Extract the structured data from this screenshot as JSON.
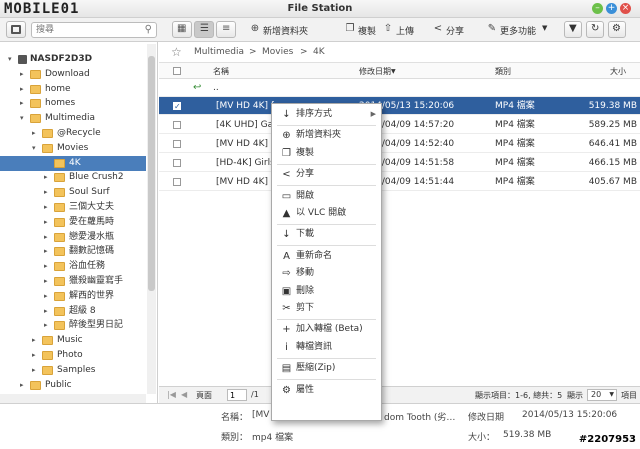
{
  "window": {
    "title": "File Station",
    "logo_text": "MOBILE01"
  },
  "toolbar": {
    "search_placeholder": "搜尋",
    "new_folder": "新增資料夾",
    "copy": "複製",
    "upload": "上傳",
    "share": "分享",
    "more": "更多功能"
  },
  "sidebar": {
    "items": [
      {
        "label": "NASDF2D3D",
        "level": 0,
        "arrow": "▾",
        "folder": false,
        "selected": false
      },
      {
        "label": "Download",
        "level": 1,
        "arrow": "▸",
        "folder": true,
        "selected": false
      },
      {
        "label": "home",
        "level": 1,
        "arrow": "▸",
        "folder": true,
        "selected": false
      },
      {
        "label": "homes",
        "level": 1,
        "arrow": "▸",
        "folder": true,
        "selected": false
      },
      {
        "label": "Multimedia",
        "level": 1,
        "arrow": "▾",
        "folder": true,
        "selected": false
      },
      {
        "label": "@Recycle",
        "level": 2,
        "arrow": "▸",
        "folder": true,
        "selected": false
      },
      {
        "label": "Movies",
        "level": 2,
        "arrow": "▾",
        "folder": true,
        "selected": false
      },
      {
        "label": "4K",
        "level": 3,
        "arrow": "",
        "folder": true,
        "selected": true
      },
      {
        "label": "Blue Crush2",
        "level": 3,
        "arrow": "▸",
        "folder": true,
        "selected": false
      },
      {
        "label": "Soul Surf",
        "level": 3,
        "arrow": "▸",
        "folder": true,
        "selected": false
      },
      {
        "label": "三個大丈夫",
        "level": 3,
        "arrow": "▸",
        "folder": true,
        "selected": false
      },
      {
        "label": "愛在蘿馬時",
        "level": 3,
        "arrow": "▸",
        "folder": true,
        "selected": false
      },
      {
        "label": "戀愛漫水瓶",
        "level": 3,
        "arrow": "▸",
        "folder": true,
        "selected": false
      },
      {
        "label": "翻數記憶碼",
        "level": 3,
        "arrow": "▸",
        "folder": true,
        "selected": false
      },
      {
        "label": "浴血任務",
        "level": 3,
        "arrow": "▸",
        "folder": true,
        "selected": false
      },
      {
        "label": "獵殺幽靈寫手",
        "level": 3,
        "arrow": "▸",
        "folder": true,
        "selected": false
      },
      {
        "label": "解西的世界",
        "level": 3,
        "arrow": "▸",
        "folder": true,
        "selected": false
      },
      {
        "label": "超級 8",
        "level": 3,
        "arrow": "▸",
        "folder": true,
        "selected": false
      },
      {
        "label": "醉後型男日記",
        "level": 3,
        "arrow": "▸",
        "folder": true,
        "selected": false
      },
      {
        "label": "Music",
        "level": 2,
        "arrow": "▸",
        "folder": true,
        "selected": false
      },
      {
        "label": "Photo",
        "level": 2,
        "arrow": "▸",
        "folder": true,
        "selected": false
      },
      {
        "label": "Samples",
        "level": 2,
        "arrow": "▸",
        "folder": true,
        "selected": false
      },
      {
        "label": "Public",
        "level": 1,
        "arrow": "▸",
        "folder": true,
        "selected": false
      }
    ]
  },
  "breadcrumb": {
    "items": [
      "Multimedia",
      "Movies",
      "4K"
    ],
    "separator": ">"
  },
  "table": {
    "headers": {
      "name": "名稱",
      "date": "修改日期",
      "type": "類別",
      "size": "大小"
    },
    "parent_row": "..",
    "rows": [
      {
        "name": "[MV HD 4K] f",
        "date": "2014/05/13 15:20:06",
        "type": "MP4 檔案",
        "size": "519.38 MB",
        "checked": true
      },
      {
        "name": "[4K UHD] Gal",
        "date": "2014/04/09 14:57:20",
        "type": "MP4 檔案",
        "size": "589.25 MB",
        "checked": false
      },
      {
        "name": "[MV HD 4K] G",
        "date": "2014/04/09 14:52:40",
        "type": "MP4 檔案",
        "size": "646.41 MB",
        "checked": false
      },
      {
        "name": "[HD-4K] Girls",
        "date": "2014/04/09 14:51:58",
        "type": "MP4 檔案",
        "size": "466.15 MB",
        "checked": false
      },
      {
        "name": "[MV HD 4K] 9",
        "date": "2014/04/09 14:51:44",
        "type": "MP4 檔案",
        "size": "405.67 MB",
        "checked": false
      }
    ]
  },
  "pager": {
    "page_label": "頁面",
    "page_value": "1",
    "page_total": "/1",
    "display_info": "顯示項目：1-6, 總共：5",
    "per_page_label": "顯示",
    "per_page_value": "20",
    "items_label": "項目"
  },
  "info": {
    "name_label": "名稱：",
    "name_value": "[MV",
    "name_value_tail": "dom Tooth (劣…",
    "date_label": "修改日期",
    "date_value": "2014/05/13 15:20:06",
    "type_label": "類別：",
    "type_value": "mp4 檔案",
    "size_label": "大小：",
    "size_value": "519.38 MB"
  },
  "watermark": "#2207953",
  "context_menu": {
    "items": [
      {
        "label": "排序方式",
        "icon": "sort-icon",
        "glyph": "↓",
        "submenu": true,
        "sep_after": true
      },
      {
        "label": "新增資料夾",
        "icon": "plus-circle-icon",
        "glyph": "⊕",
        "submenu": false,
        "sep_after": false
      },
      {
        "label": "複製",
        "icon": "copy-icon",
        "glyph": "❐",
        "submenu": false,
        "sep_after": true
      },
      {
        "label": "分享",
        "icon": "share-icon",
        "glyph": "<",
        "submenu": false,
        "sep_after": true
      },
      {
        "label": "開啟",
        "icon": "folder-open-icon",
        "glyph": "▭",
        "submenu": false,
        "sep_after": false
      },
      {
        "label": "以 VLC 開啟",
        "icon": "vlc-icon",
        "glyph": "▲",
        "submenu": false,
        "sep_after": true
      },
      {
        "label": "下載",
        "icon": "download-icon",
        "glyph": "↓",
        "submenu": false,
        "sep_after": true
      },
      {
        "label": "重新命名",
        "icon": "rename-icon",
        "glyph": "A",
        "submenu": false,
        "sep_after": false
      },
      {
        "label": "移動",
        "icon": "move-icon",
        "glyph": "⇨",
        "submenu": false,
        "sep_after": false
      },
      {
        "label": "刪除",
        "icon": "trash-icon",
        "glyph": "▣",
        "submenu": false,
        "sep_after": false
      },
      {
        "label": "剪下",
        "icon": "scissors-icon",
        "glyph": "✂",
        "submenu": false,
        "sep_after": true
      },
      {
        "label": "加入轉檔 (Beta)",
        "icon": "plus-icon",
        "glyph": "+",
        "submenu": false,
        "sep_after": false
      },
      {
        "label": "轉檔資訊",
        "icon": "info-icon",
        "glyph": "i",
        "submenu": false,
        "sep_after": true
      },
      {
        "label": "壓縮(Zip)",
        "icon": "zip-icon",
        "glyph": "▤",
        "submenu": false,
        "sep_after": true
      },
      {
        "label": "屬性",
        "icon": "properties-icon",
        "glyph": "⚙",
        "submenu": false,
        "sep_after": false
      }
    ]
  },
  "colors": {
    "selection": "#2f5f9e",
    "tree_selection": "#4a7ebb",
    "folder": "#f3c35b",
    "green": "#6cc04a",
    "blue": "#3a8fd8",
    "red": "#e0504a"
  }
}
